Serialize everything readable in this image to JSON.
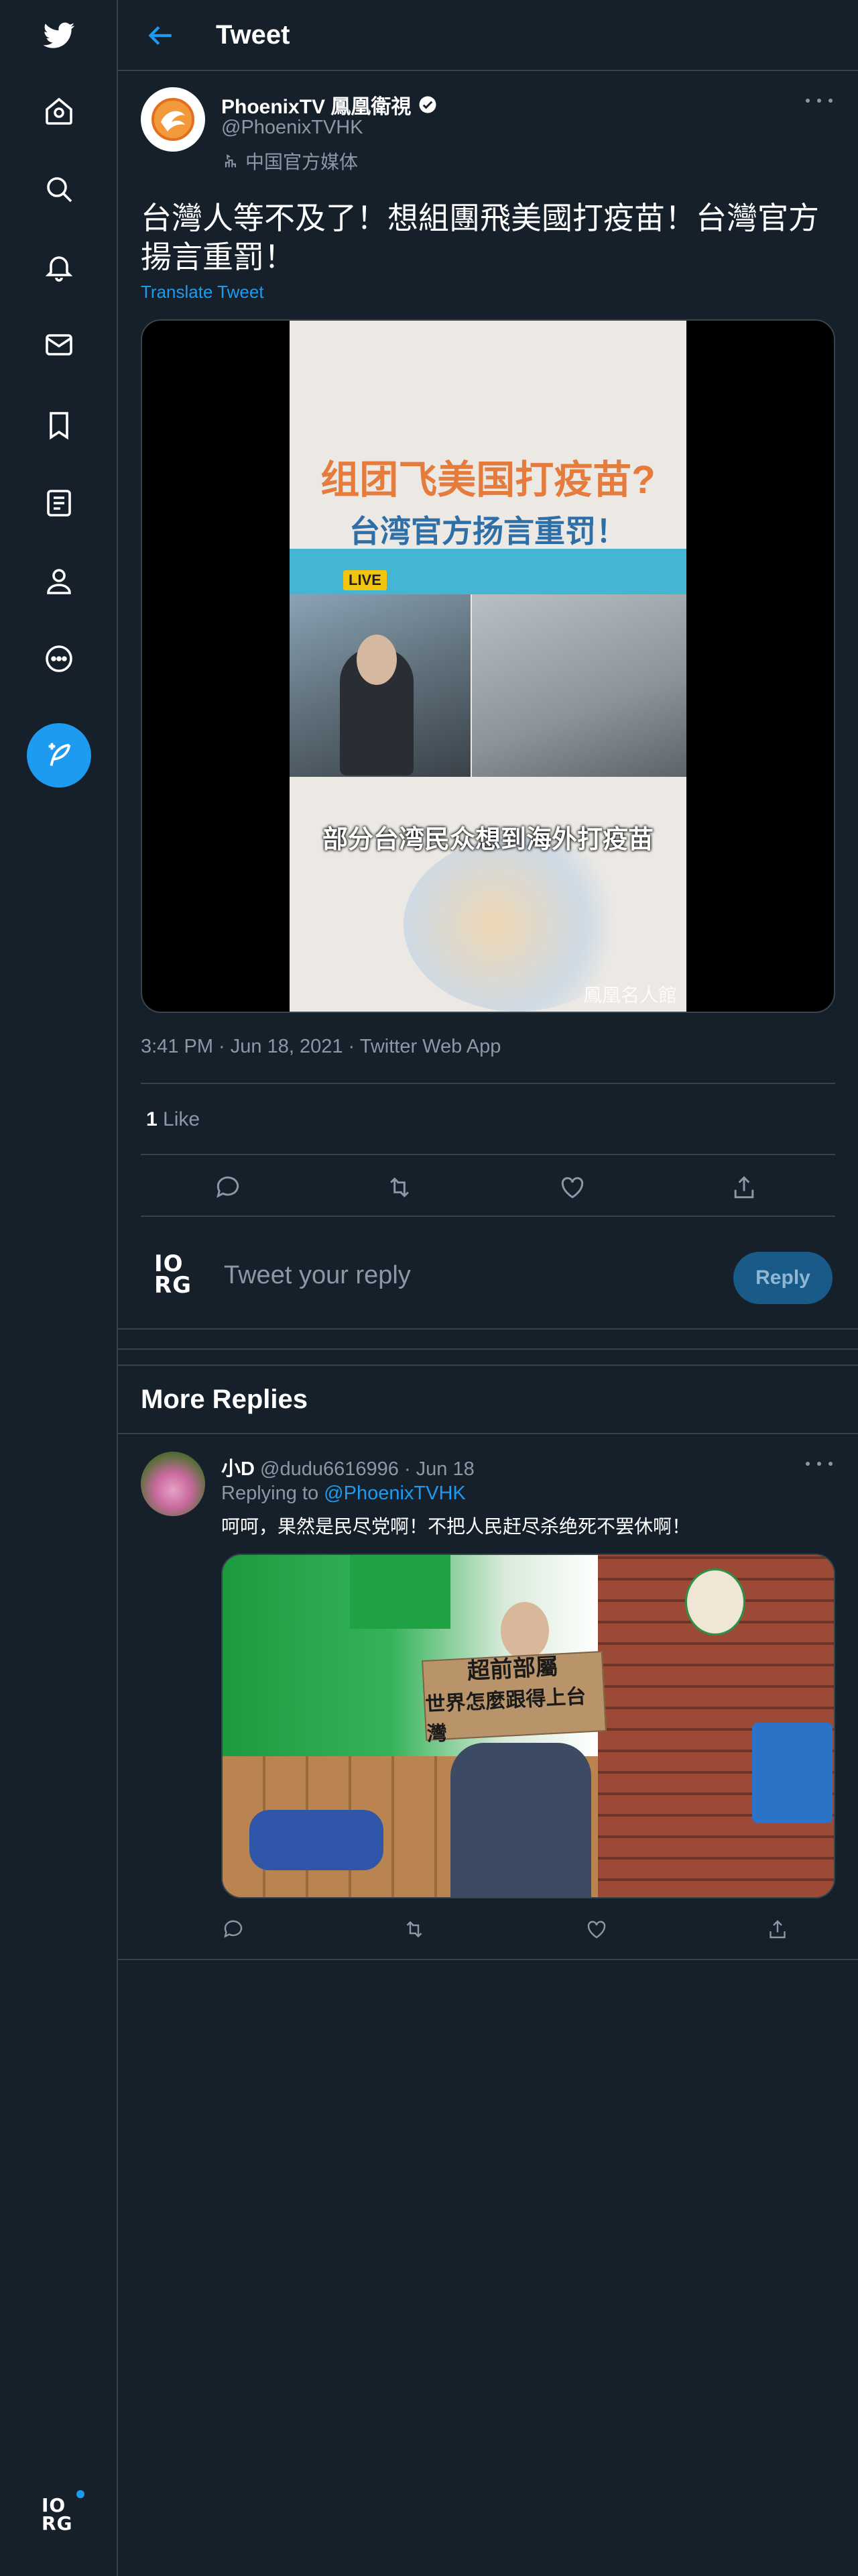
{
  "app": {
    "name": "Twitter",
    "accent": "#1d9bf0",
    "background": "#15202b",
    "border": "#38444d"
  },
  "sidebar": {
    "items": [
      {
        "name": "home",
        "icon": "home-icon"
      },
      {
        "name": "explore",
        "icon": "search-icon"
      },
      {
        "name": "notifications",
        "icon": "bell-icon"
      },
      {
        "name": "messages",
        "icon": "mail-icon"
      },
      {
        "name": "bookmarks",
        "icon": "bookmark-icon"
      },
      {
        "name": "lists",
        "icon": "list-icon"
      },
      {
        "name": "profile",
        "icon": "person-icon"
      },
      {
        "name": "more",
        "icon": "more-circle-icon"
      }
    ],
    "compose_icon": "feather-plus-icon",
    "account_logo": {
      "line1": "IO",
      "line2": "RG"
    }
  },
  "header": {
    "title": "Tweet"
  },
  "tweet": {
    "author_name": "PhoenixTV 鳳凰衛視",
    "author_handle": "@PhoenixTVHK",
    "media_label": "中国官方媒体",
    "text": "台灣人等不及了！想組團飛美國打疫苗！台灣官方揚言重罰！",
    "translate": "Translate Tweet",
    "video": {
      "title_line1": "组团飞美国打疫苗?",
      "title_line2": "台湾官方扬言重罚！",
      "live_badge": "LIVE",
      "caption": "部分台湾民众想到海外打疫苗",
      "watermark": "鳳凰名人館"
    },
    "timestamp": "3:41 PM · Jun 18, 2021 · Twitter Web App",
    "likes_count": "1",
    "likes_label": "Like"
  },
  "compose_reply": {
    "avatar": {
      "line1": "IO",
      "line2": "RG"
    },
    "placeholder": "Tweet your reply",
    "button": "Reply"
  },
  "more_replies": {
    "title": "More Replies",
    "replies": [
      {
        "name": "小D",
        "handle": "@dudu6616996",
        "date": "Jun 18",
        "replying_label": "Replying to",
        "replying_to": "@PhoenixTVHK",
        "text": "呵呵，果然是民尽党啊！不把人民赶尽杀绝死不罢休啊！",
        "image": {
          "sign_line1": "超前部屬",
          "sign_line2": "世界怎麼跟得上台灣"
        }
      }
    ]
  }
}
